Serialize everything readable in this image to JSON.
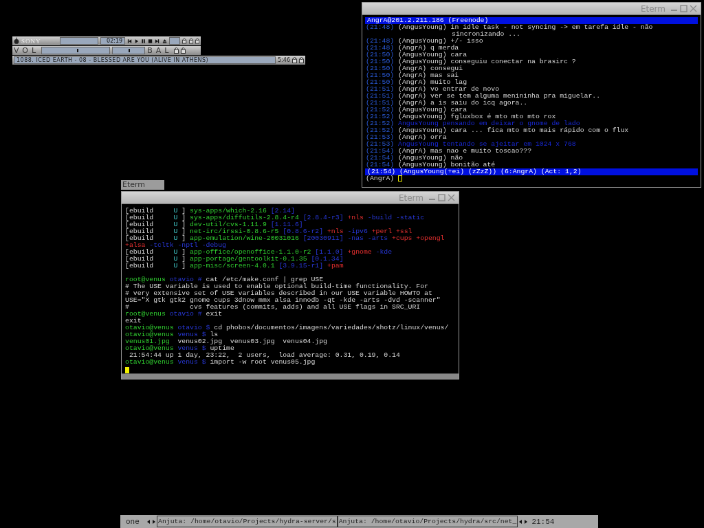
{
  "player": {
    "logo": "SONY",
    "time": "02:19",
    "volume_label": "VOL",
    "balance_label": "BAL",
    "volume": {
      "level": 0.52
    },
    "balance": {
      "level": 0.5
    },
    "track": "1088. ICED EARTH - 08 - BLESSED ARE YOU (ALIVE IN ATHENS)",
    "duration": "5:46"
  },
  "irc_window": {
    "title": "Eterm",
    "topic": "AngrA@201.2.211.186 (Freenode)",
    "lines": [
      {
        "kind": "msg",
        "time": "(21:48)",
        "nick": "(AngusYoung)",
        "text": "in idle task - not syncing -> em tarefa idle - não"
      },
      {
        "kind": "wrap",
        "text": "sincronizando ..."
      },
      {
        "kind": "msg",
        "time": "(21:48)",
        "nick": "(AngusYoung)",
        "text": "+/- isso"
      },
      {
        "kind": "msg",
        "time": "(21:48)",
        "nick": "(AngrA)",
        "text": "q merda"
      },
      {
        "kind": "msg",
        "time": "(21:50)",
        "nick": "(AngusYoung)",
        "text": "cara"
      },
      {
        "kind": "msg",
        "time": "(21:50)",
        "nick": "(AngusYoung)",
        "text": "conseguiu conectar na brasirc ?"
      },
      {
        "kind": "msg",
        "time": "(21:50)",
        "nick": "(AngrA)",
        "text": "consegui"
      },
      {
        "kind": "msg",
        "time": "(21:50)",
        "nick": "(AngrA)",
        "text": "mas sai"
      },
      {
        "kind": "msg",
        "time": "(21:50)",
        "nick": "(AngrA)",
        "text": "muito lag"
      },
      {
        "kind": "msg",
        "time": "(21:51)",
        "nick": "(AngrA)",
        "text": "vo entrar de novo"
      },
      {
        "kind": "msg",
        "time": "(21:51)",
        "nick": "(AngrA)",
        "text": "ver se tem alguma menininha pra miguelar.."
      },
      {
        "kind": "msg",
        "time": "(21:51)",
        "nick": "(AngrA)",
        "text": "a is saiu do icq agora.."
      },
      {
        "kind": "msg",
        "time": "(21:52)",
        "nick": "(AngusYoung)",
        "text": "cara"
      },
      {
        "kind": "msg",
        "time": "(21:52)",
        "nick": "(AngusYoung)",
        "text": "fgluxbox é mto mto mto rox"
      },
      {
        "kind": "action",
        "time": "(21:52)",
        "text": "AngusYoung pensando em deixar o gnome de lado"
      },
      {
        "kind": "msg",
        "time": "(21:52)",
        "nick": "(AngusYoung)",
        "text": "cara ... fica mto mto mais rápido com o flux"
      },
      {
        "kind": "msg",
        "time": "(21:53)",
        "nick": "(AngrA)",
        "text": "orra"
      },
      {
        "kind": "action",
        "time": "(21:53)",
        "text": "AngusYoung tentando se ajeitar em 1024 x 768"
      },
      {
        "kind": "msg",
        "time": "(21:54)",
        "nick": "(AngrA)",
        "text": "mas nao e muito toscao???"
      },
      {
        "kind": "msg",
        "time": "(21:54)",
        "nick": "(AngusYoung)",
        "text": "não"
      },
      {
        "kind": "msg",
        "time": "(21:54)",
        "nick": "(AngusYoung)",
        "text": "bonitão até"
      }
    ],
    "status": "(21:54) (AngusYoung(+ei) (zZzZ)) (6:AngrA) (Act: 1,2)",
    "prompt": "(AngrA)"
  },
  "iconified_window": {
    "title": "Eterm"
  },
  "terminal_window": {
    "title": "Eterm",
    "lines": [
      {
        "kind": "text",
        "segments": [
          {
            "text": "[ebuild     ",
            "kind": "text"
          },
          {
            "text": "U",
            "kind": "status"
          },
          {
            "text": " ] ",
            "kind": "text"
          },
          {
            "text": "sys-apps/which-2.16",
            "kind": "package"
          },
          {
            "text": " [2.14]",
            "kind": "version"
          }
        ]
      },
      {
        "kind": "text",
        "segments": [
          {
            "text": "[ebuild     ",
            "kind": "text"
          },
          {
            "text": "U",
            "kind": "status"
          },
          {
            "text": " ] ",
            "kind": "text"
          },
          {
            "text": "sys-apps/diffutils-2.8.4-r4",
            "kind": "package"
          },
          {
            "text": " [2.8.4-r3]",
            "kind": "version"
          },
          {
            "text": " +nls",
            "kind": "use_on"
          },
          {
            "text": " -build -static",
            "kind": "use_off"
          }
        ]
      },
      {
        "kind": "text",
        "segments": [
          {
            "text": "[ebuild     ",
            "kind": "text"
          },
          {
            "text": "U",
            "kind": "status"
          },
          {
            "text": " ] ",
            "kind": "text"
          },
          {
            "text": "dev-util/cvs-1.11.9",
            "kind": "package"
          },
          {
            "text": " [1.11.6]",
            "kind": "version"
          }
        ]
      },
      {
        "kind": "text",
        "segments": [
          {
            "text": "[ebuild     ",
            "kind": "text"
          },
          {
            "text": "U",
            "kind": "status"
          },
          {
            "text": " ] ",
            "kind": "text"
          },
          {
            "text": "net-irc/irssi-0.8.6-r5",
            "kind": "package"
          },
          {
            "text": " [0.8.6-r2]",
            "kind": "version"
          },
          {
            "text": " +nls",
            "kind": "use_on"
          },
          {
            "text": " -ipv6",
            "kind": "use_off"
          },
          {
            "text": " +perl +ssl",
            "kind": "use_on"
          }
        ]
      },
      {
        "kind": "text",
        "segments": [
          {
            "text": "[ebuild     ",
            "kind": "text"
          },
          {
            "text": "U",
            "kind": "status"
          },
          {
            "text": " ] ",
            "kind": "text"
          },
          {
            "text": "app-emulation/wine-20031016",
            "kind": "package"
          },
          {
            "text": " [20030911]",
            "kind": "version"
          },
          {
            "text": " -nas -arts",
            "kind": "use_off"
          },
          {
            "text": " +cups +opengl",
            "kind": "use_on"
          }
        ]
      },
      {
        "kind": "text",
        "segments": [
          {
            "text": "+alsa",
            "kind": "use_on"
          },
          {
            "text": " -tcltk -nptl -debug",
            "kind": "use_off"
          }
        ]
      },
      {
        "kind": "text",
        "segments": [
          {
            "text": "[ebuild     ",
            "kind": "text"
          },
          {
            "text": "U",
            "kind": "status"
          },
          {
            "text": " ] ",
            "kind": "text"
          },
          {
            "text": "app-office/openoffice-1.1.0-r2",
            "kind": "package"
          },
          {
            "text": " [1.1.0]",
            "kind": "version"
          },
          {
            "text": " +gnome",
            "kind": "use_on"
          },
          {
            "text": " -kde",
            "kind": "use_off"
          }
        ]
      },
      {
        "kind": "text",
        "segments": [
          {
            "text": "[ebuild     ",
            "kind": "text"
          },
          {
            "text": "U",
            "kind": "status"
          },
          {
            "text": " ] ",
            "kind": "text"
          },
          {
            "text": "app-portage/gentoolkit-0.1.35",
            "kind": "package"
          },
          {
            "text": " [0.1.34]",
            "kind": "version"
          }
        ]
      },
      {
        "kind": "text",
        "segments": [
          {
            "text": "[ebuild     ",
            "kind": "text"
          },
          {
            "text": "U",
            "kind": "status"
          },
          {
            "text": " ] ",
            "kind": "text"
          },
          {
            "text": "app-misc/screen-4.0.1",
            "kind": "package"
          },
          {
            "text": " [3.9.15-r1]",
            "kind": "version"
          },
          {
            "text": " +pam",
            "kind": "use_on"
          }
        ]
      },
      {
        "kind": "blank"
      },
      {
        "kind": "text",
        "segments": [
          {
            "text": "root@venus",
            "kind": "host"
          },
          {
            "text": " otavio #",
            "kind": "dir"
          },
          {
            "text": " cat /etc/make.conf | grep USE",
            "kind": "text"
          }
        ]
      },
      {
        "kind": "text",
        "segments": [
          {
            "text": "# The USE variable is used to enable optional build-time functionality. For",
            "kind": "text"
          }
        ]
      },
      {
        "kind": "text",
        "segments": [
          {
            "text": "# very extensive set of USE variables described in our USE variable HOWTO at",
            "kind": "text"
          }
        ]
      },
      {
        "kind": "text",
        "segments": [
          {
            "text": "USE=\"X gtk gtk2 gnome cups 3dnow mmx alsa innodb -qt -kde -arts -dvd -scanner\"",
            "kind": "text"
          }
        ]
      },
      {
        "kind": "text",
        "segments": [
          {
            "text": "#               cvs features (commits, adds) and all USE flags in SRC_URI",
            "kind": "text"
          }
        ]
      },
      {
        "kind": "text",
        "segments": [
          {
            "text": "root@venus",
            "kind": "host"
          },
          {
            "text": " otavio #",
            "kind": "dir"
          },
          {
            "text": " exit",
            "kind": "text"
          }
        ]
      },
      {
        "kind": "text",
        "segments": [
          {
            "text": "exit",
            "kind": "text"
          }
        ]
      },
      {
        "kind": "text",
        "segments": [
          {
            "text": "otavio@venus",
            "kind": "host"
          },
          {
            "text": " otavio $",
            "kind": "dir"
          },
          {
            "text": " cd phobos/documentos/imagens/variedades/shotz/linux/venus/",
            "kind": "text"
          }
        ]
      },
      {
        "kind": "text",
        "segments": [
          {
            "text": "otavio@venus",
            "kind": "host"
          },
          {
            "text": " venus $",
            "kind": "dir"
          },
          {
            "text": " ls",
            "kind": "text"
          }
        ]
      },
      {
        "kind": "text",
        "segments": [
          {
            "text": "venus01.jpg",
            "kind": "file"
          },
          {
            "text": "  venus02.jpg  venus03.jpg  venus04.jpg",
            "kind": "text"
          }
        ]
      },
      {
        "kind": "text",
        "segments": [
          {
            "text": "otavio@venus",
            "kind": "host"
          },
          {
            "text": " venus $",
            "kind": "dir"
          },
          {
            "text": " uptime",
            "kind": "text"
          }
        ]
      },
      {
        "kind": "text",
        "segments": [
          {
            "text": " 21:54:44 up 1 day, 23:22,  2 users,  load average: 0.31, 0.19, 0.14",
            "kind": "text"
          }
        ]
      },
      {
        "kind": "text",
        "segments": [
          {
            "text": "otavio@venus",
            "kind": "host"
          },
          {
            "text": " venus $",
            "kind": "dir"
          },
          {
            "text": " import -w root venus05.jpg",
            "kind": "text"
          }
        ]
      },
      {
        "kind": "cursor"
      }
    ]
  },
  "taskbar": {
    "workspace": "one",
    "tasks": [
      {
        "label": "Anjuta: /home/otavio/Projects/hydra-server/s",
        "selected": false
      },
      {
        "label": "Anjuta: /home/otavio/Projects/hydra/src/net_",
        "selected": false
      }
    ],
    "clock": "21:54"
  }
}
